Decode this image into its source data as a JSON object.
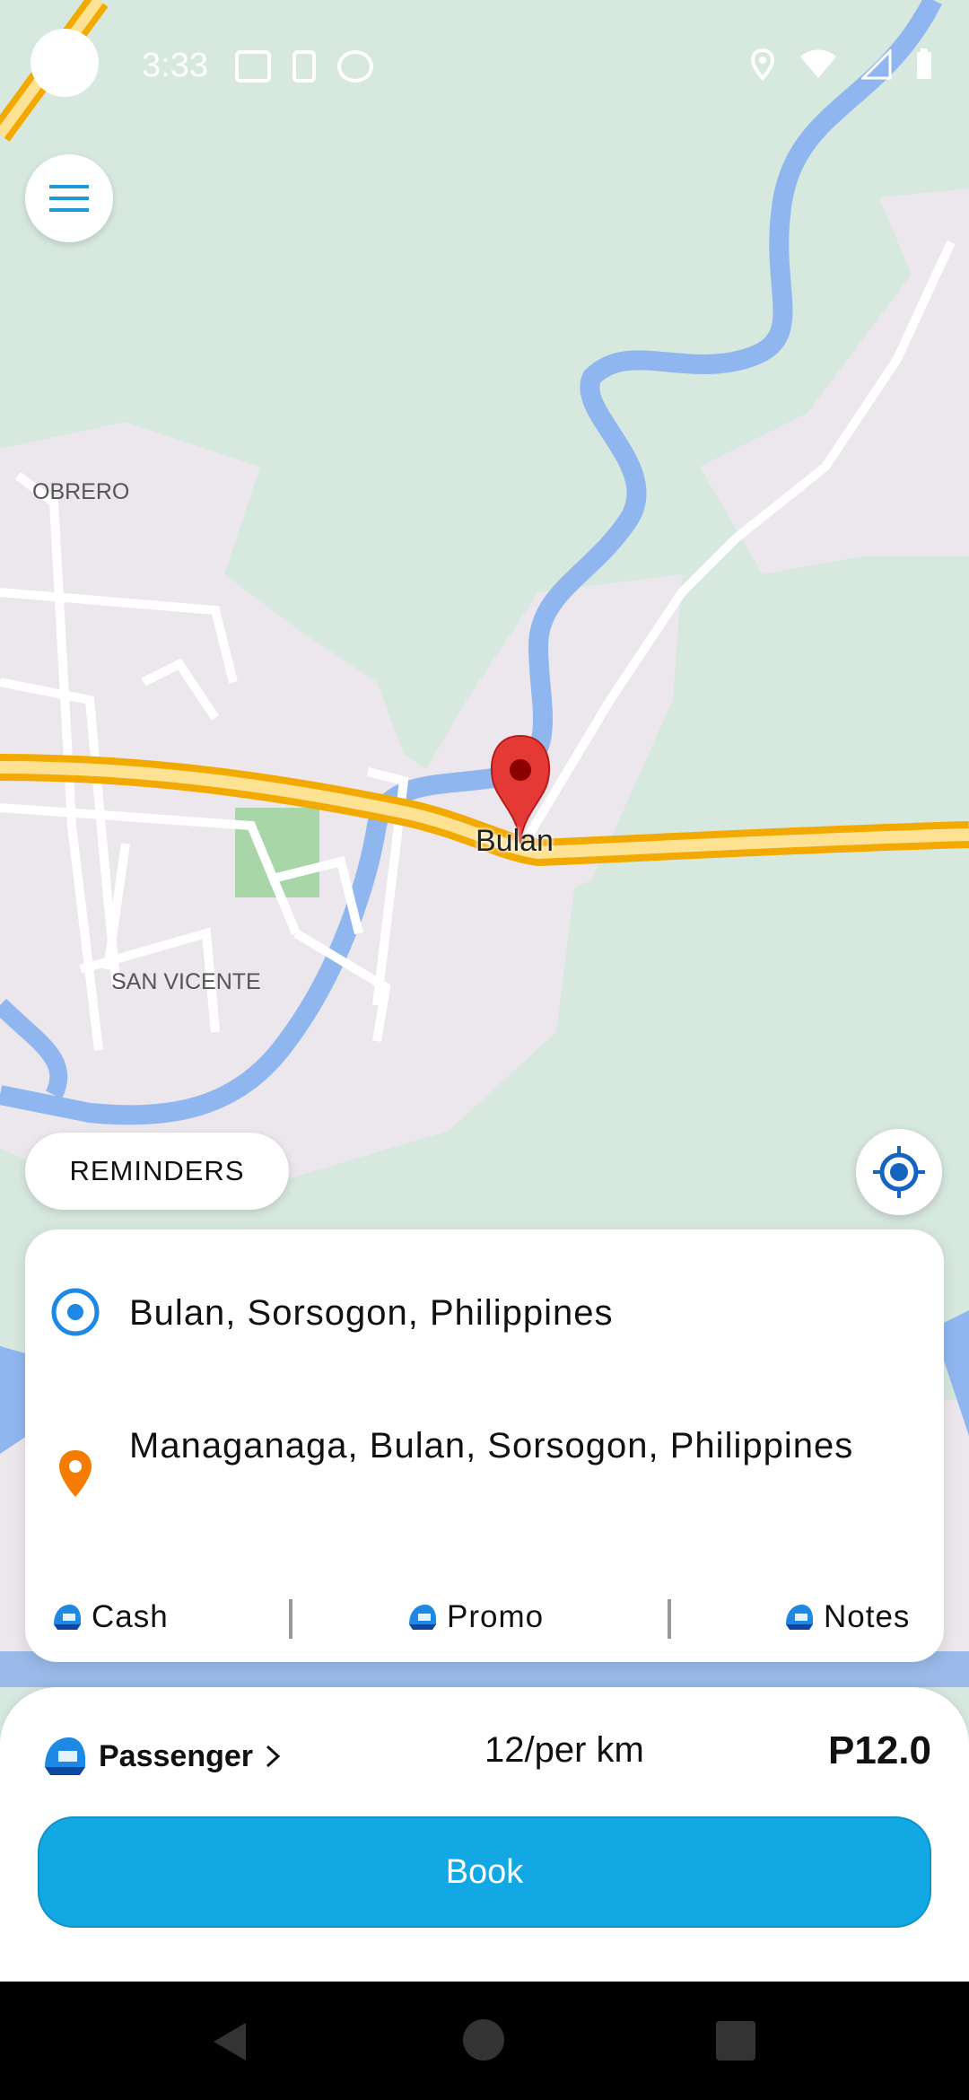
{
  "status_bar": {
    "time": "3:33"
  },
  "map": {
    "labels": [
      "OBRERO",
      "SAN VICENTE"
    ],
    "town": "Bulan"
  },
  "reminders": {
    "label": "REMINDERS"
  },
  "route": {
    "pickup": "Bulan, Sorsogon, Philippines",
    "dropoff": "Managanaga, Bulan, Sorsogon, Philippines"
  },
  "payment": {
    "cash": "Cash",
    "promo": "Promo",
    "notes": "Notes"
  },
  "ride": {
    "type": "Passenger",
    "rate": "12/per km",
    "price": "P12.0"
  },
  "book": {
    "label": "Book"
  },
  "colors": {
    "accent": "#12a8e4",
    "pickup_icon": "#1e88e5",
    "dropoff_icon": "#f57c00",
    "road": "#f5b21a",
    "river": "#8fb6ef"
  },
  "icons": {
    "menu": "hamburger-icon",
    "locate": "crosshair-icon",
    "pickup": "radio-origin-icon",
    "dropoff": "location-pin-icon",
    "payment": "helmet-icon",
    "nav_back": "triangle-back-icon",
    "nav_home": "circle-home-icon",
    "nav_recent": "square-recent-icon"
  }
}
